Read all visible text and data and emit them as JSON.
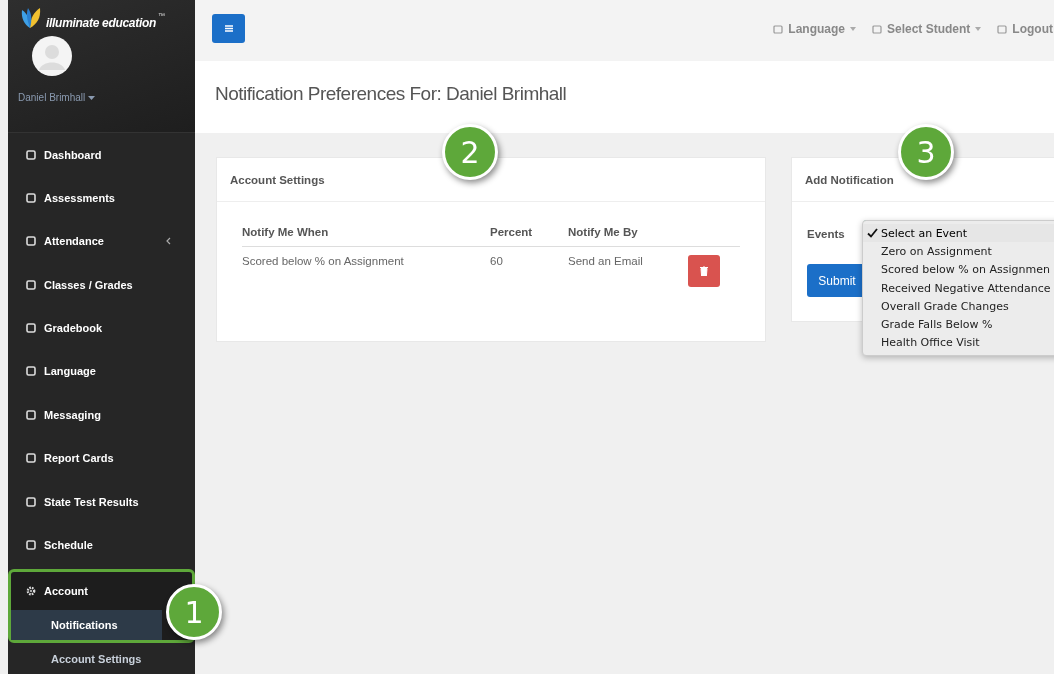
{
  "sidebar": {
    "logo": "illuminate education",
    "logo_mark": "™",
    "user": "Daniel Brimhall",
    "items": [
      {
        "label": "Dashboard",
        "submenu": false
      },
      {
        "label": "Assessments",
        "submenu": false
      },
      {
        "label": "Attendance",
        "submenu": true
      },
      {
        "label": "Classes / Grades",
        "submenu": false
      },
      {
        "label": "Gradebook",
        "submenu": false
      },
      {
        "label": "Language",
        "submenu": false
      },
      {
        "label": "Messaging",
        "submenu": false
      },
      {
        "label": "Report Cards",
        "submenu": false
      },
      {
        "label": "State Test Results",
        "submenu": false
      },
      {
        "label": "Schedule",
        "submenu": false
      },
      {
        "label": "Account",
        "expanded": true,
        "highlighted": true,
        "children": [
          {
            "label": "Notifications",
            "selected": true
          },
          {
            "label": "Account Settings",
            "selected": false
          }
        ]
      }
    ]
  },
  "topbar": {
    "links": [
      "Language",
      "Select Student",
      "Logout"
    ]
  },
  "page_title": "Notification Preferences For: Daniel Brimhall",
  "account_settings": {
    "title": "Account Settings",
    "columns": [
      "Notify Me When",
      "Percent",
      "Notify Me By"
    ],
    "rows": [
      {
        "event": "Scored below % on Assignment",
        "percent": "60",
        "method": "Send an Email"
      }
    ]
  },
  "add_notification": {
    "title": "Add Notification",
    "events_label": "Events",
    "submit": "Submit",
    "options": [
      {
        "label": "Select an Event",
        "selected": true
      },
      {
        "label": "Zero on Assignment",
        "selected": false
      },
      {
        "label": "Scored below % on Assignmen",
        "selected": false
      },
      {
        "label": "Received Negative Attendance",
        "selected": false
      },
      {
        "label": "Overall Grade Changes",
        "selected": false
      },
      {
        "label": "Grade Falls Below %",
        "selected": false
      },
      {
        "label": "Health Office Visit",
        "selected": false
      }
    ]
  },
  "callouts": [
    "1",
    "2",
    "3"
  ]
}
